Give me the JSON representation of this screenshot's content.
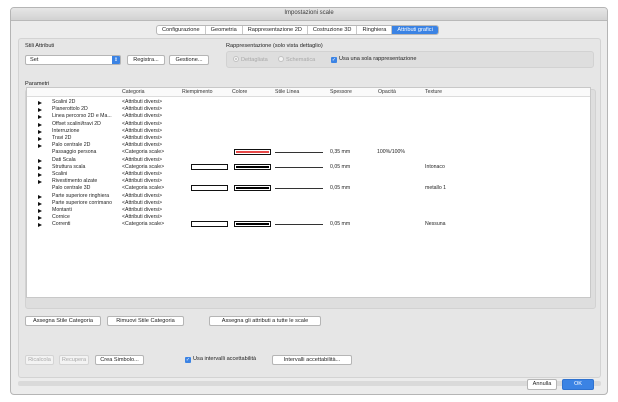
{
  "window": {
    "title": "Impostazioni scale"
  },
  "tabs": [
    {
      "label": "Configurazione",
      "active": false
    },
    {
      "label": "Geometria",
      "active": false
    },
    {
      "label": "Rappresentazione 2D",
      "active": false
    },
    {
      "label": "Costruzione 3D",
      "active": false
    },
    {
      "label": "Ringhiera",
      "active": false
    },
    {
      "label": "Attributi grafici",
      "active": true
    }
  ],
  "stili": {
    "label": "Stili Attributi",
    "popup_value": "Set",
    "registra": "Registra...",
    "gestione": "Gestione..."
  },
  "rappresentazione": {
    "label": "Rappresentazione (solo vista dettaglio)",
    "dettagliata": "Dettagliata",
    "schematica": "Schematica",
    "usa_sola": "Usa una sola rappresentazione"
  },
  "parametri": {
    "label": "Parametri"
  },
  "table": {
    "headers": [
      "Categoria",
      "Riempimento",
      "Colore",
      "Stile Linea",
      "Spessore",
      "Opacità",
      "Texture"
    ],
    "rows": [
      {
        "name": "Scalini 2D",
        "cat": "<Attributi diversi>",
        "arrow": true
      },
      {
        "name": "Pianerottolo 2D",
        "cat": "<Attributi diversi>",
        "arrow": true
      },
      {
        "name": "Linea percorso 2D e Ma...",
        "cat": "<Attributi diversi>",
        "arrow": true
      },
      {
        "name": "Offset scalini/travi 2D",
        "cat": "<Attributi diversi>",
        "arrow": true
      },
      {
        "name": "Interruzione",
        "cat": "<Attributi diversi>",
        "arrow": true
      },
      {
        "name": "Travi 2D",
        "cat": "<Attributi diversi>",
        "arrow": true
      },
      {
        "name": "Palo centrale 2D",
        "cat": "<Attributi diversi>",
        "arrow": true
      },
      {
        "name": "Passaggio persona",
        "cat": "<Categoria scale>",
        "arrow": false,
        "fill": false,
        "color": "#e84848",
        "spessore": "0,35 mm",
        "opacita": "100%/100%",
        "texture": ""
      },
      {
        "name": "Dati Scala",
        "cat": "<Attributi diversi>",
        "arrow": true
      },
      {
        "name": "Struttura scala",
        "cat": "<Categoria scale>",
        "arrow": true,
        "fill": true,
        "color": "#000000",
        "spessore": "0,05 mm",
        "opacita": "",
        "texture": "Intonaco"
      },
      {
        "name": "Scalini",
        "cat": "<Attributi diversi>",
        "arrow": true
      },
      {
        "name": "Rivestimento alzate",
        "cat": "<Attributi diversi>",
        "arrow": true
      },
      {
        "name": "Palo centrale 3D",
        "cat": "<Categoria scale>",
        "arrow": false,
        "fill": true,
        "color": "#000000",
        "spessore": "0,05 mm",
        "opacita": "",
        "texture": "metallo 1"
      },
      {
        "name": "Parte superiore ringhiera",
        "cat": "<Attributi diversi>",
        "arrow": true
      },
      {
        "name": "Parte superiore corrimano",
        "cat": "<Attributi diversi>",
        "arrow": true
      },
      {
        "name": "Montanti",
        "cat": "<Attributi diversi>",
        "arrow": true
      },
      {
        "name": "Cornice",
        "cat": "<Attributi diversi>",
        "arrow": true
      },
      {
        "name": "Correnti",
        "cat": "<Categoria scale>",
        "arrow": true,
        "fill": true,
        "color": "#000000",
        "spessore": "0,05 mm",
        "opacita": "",
        "texture": "Nessuna"
      }
    ]
  },
  "buttons": {
    "assegna_stile": "Assegna Stile Categoria",
    "rimuovi_stile": "Rimuovi Stile Categoria",
    "assegna_tutte": "Assegna gli attributi a tutte le scale",
    "ricalcola": "Ricalcola",
    "recupera": "Recupera",
    "crea_simbolo": "Crea Simbolo...",
    "usa_intervalli": "Usa intervalli accettabilità",
    "intervalli": "Intervalli accettabilità...",
    "annulla": "Annulla",
    "ok": "OK"
  },
  "colors": {
    "accent": "#3b83e4",
    "red_swatch": "#e84848"
  },
  "icons": {
    "disclosure": "disclosure-triangle-icon",
    "popup": "chevron-updown-icon",
    "checkbox": "checkmark-icon"
  }
}
